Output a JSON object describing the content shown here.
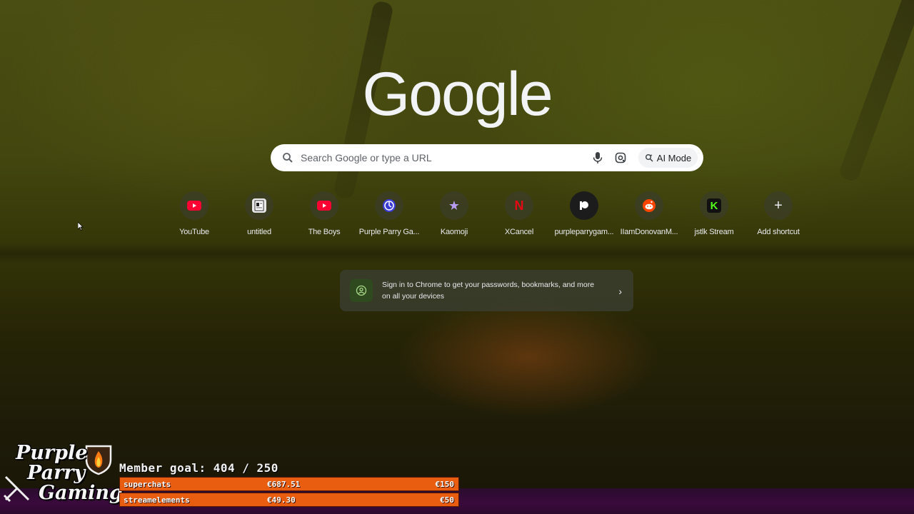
{
  "google": {
    "logo_text": "Google",
    "search_placeholder": "Search Google or type a URL",
    "ai_mode_label": "AI Mode"
  },
  "shortcuts": [
    {
      "label": "YouTube",
      "icon": "youtube-icon",
      "color": "#ff0033"
    },
    {
      "label": "untitled",
      "icon": "document-icon",
      "color": "#ffffff"
    },
    {
      "label": "The Boys",
      "icon": "youtube-icon",
      "color": "#ff0033"
    },
    {
      "label": "Purple Parry Ga...",
      "icon": "purple-clock-icon",
      "color": "#3b3bd6"
    },
    {
      "label": "Kaomoji",
      "icon": "star-icon",
      "color": "#a78bfa"
    },
    {
      "label": "XCancel",
      "icon": "netflix-n-icon",
      "color": "#e50914"
    },
    {
      "label": "purpleparrygam...",
      "icon": "patreon-icon",
      "color": "#ffffff"
    },
    {
      "label": "IIamDonovanM...",
      "icon": "reddit-icon",
      "color": "#ff4500"
    },
    {
      "label": "jstlk Stream",
      "icon": "kick-icon",
      "color": "#53fc18"
    },
    {
      "label": "Add shortcut",
      "icon": "plus-icon",
      "color": "#e8eaed"
    }
  ],
  "signin_prompt": {
    "text": "Sign in to Chrome to get your passwords, bookmarks, and more on all your devices"
  },
  "stream_overlay": {
    "brand_lines": [
      "Purple",
      "Parry",
      "Gaming"
    ],
    "member_goal": "Member goal: 404 / 250",
    "goals": [
      {
        "name": "superchats",
        "value": "€687.51",
        "target": "€150"
      },
      {
        "name": "streamelements",
        "value": "€49.30",
        "target": "€50"
      }
    ],
    "colors": {
      "goal_bar": "#e85d10",
      "bottom_bar": "#3a0a3c"
    }
  }
}
